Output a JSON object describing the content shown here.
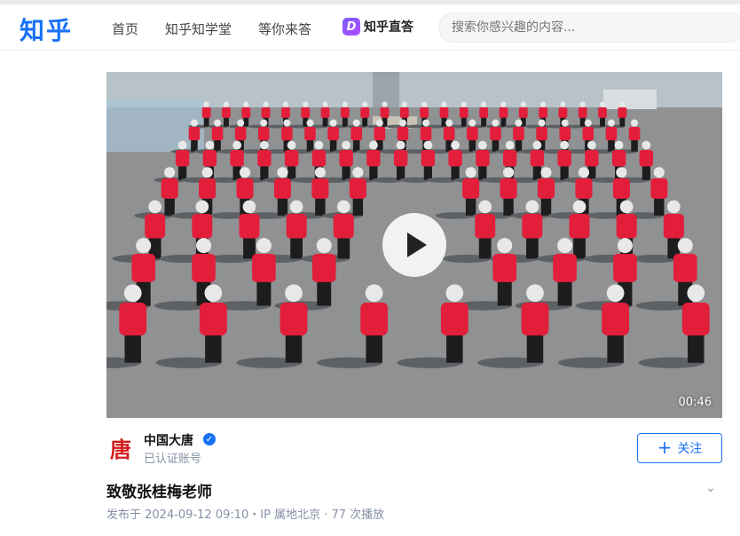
{
  "header": {
    "logo": "知乎",
    "nav": [
      "首页",
      "知乎知学堂",
      "等你来答"
    ],
    "zhida_label": "知乎直答",
    "search_placeholder": "搜索你感兴趣的内容..."
  },
  "video": {
    "duration": "00:46"
  },
  "author": {
    "logo_char": "唐",
    "name": "中国大唐",
    "subtitle": "已认证账号",
    "follow_label": "关注"
  },
  "post": {
    "title": "致敬张桂梅老师",
    "meta": "发布于 2024-09-12 09:10・IP 属地北京 · 77 次播放"
  },
  "colors": {
    "brand": "#1772f6",
    "jacket_red": "#e31e3a"
  }
}
